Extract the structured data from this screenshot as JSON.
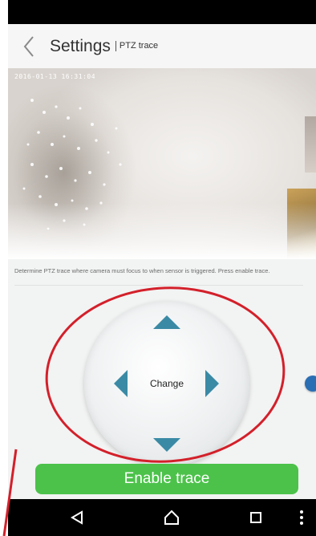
{
  "header": {
    "title": "Settings",
    "subtitle": "PTZ trace"
  },
  "camera": {
    "timestamp": "2016-01-13 16:31:04"
  },
  "instruction": "Determine PTZ trace where camera must focus to when sensor is triggered. Press enable trace.",
  "ptz": {
    "change_label": "Change"
  },
  "actions": {
    "enable_label": "Enable trace"
  },
  "colors": {
    "accent_green": "#4cc24a",
    "arrow_blue": "#3a8aa5",
    "annotation_red": "#d3202a"
  },
  "icons": {
    "back": "chevron-left-icon",
    "nav_back": "triangle-back-icon",
    "nav_home": "home-icon",
    "nav_recent": "square-recent-icon",
    "nav_menu": "vertical-dots-icon"
  }
}
